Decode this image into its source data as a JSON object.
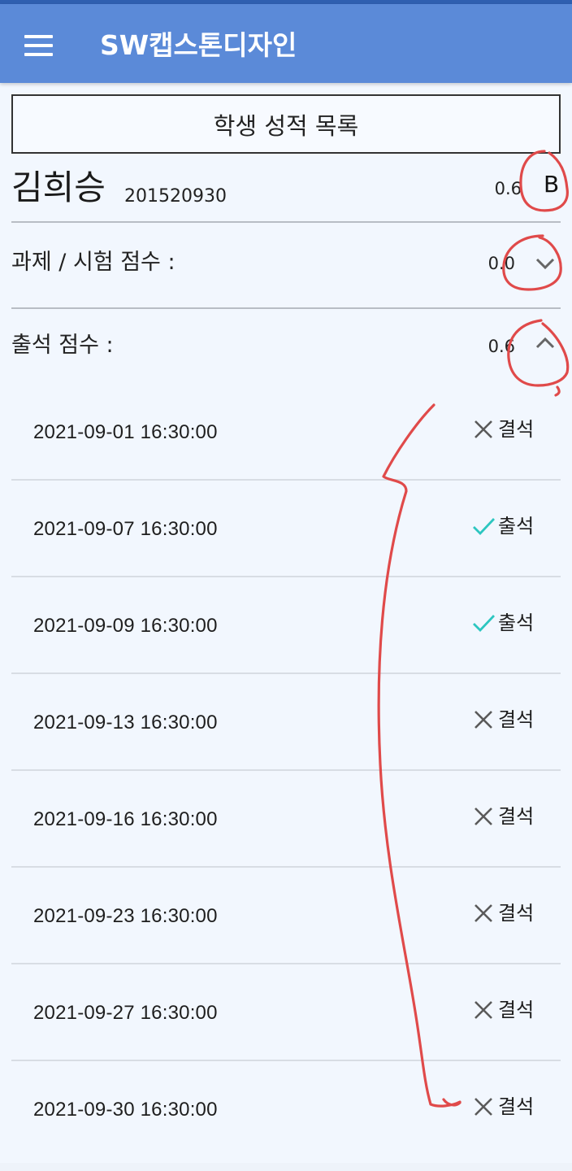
{
  "appbar": {
    "title": "SW캡스톤디자인",
    "menu_icon": "menu-icon"
  },
  "list_button": {
    "label": "학생 성적 목록"
  },
  "student": {
    "name": "김희승",
    "id": "201520930",
    "total_score": "0.6",
    "grade": "B"
  },
  "sections": [
    {
      "label": "과제 / 시험 점수 :",
      "score": "0.0",
      "icon": "chevron-down-icon",
      "expanded": false
    },
    {
      "label": "출석 점수 :",
      "score": "0.6",
      "icon": "chevron-up-icon",
      "expanded": true
    }
  ],
  "attendance": [
    {
      "date": "2021-09-01 16:30:00",
      "status": "결석",
      "icon": "x-icon"
    },
    {
      "date": "2021-09-07 16:30:00",
      "status": "출석",
      "icon": "check-icon"
    },
    {
      "date": "2021-09-09 16:30:00",
      "status": "출석",
      "icon": "check-icon"
    },
    {
      "date": "2021-09-13 16:30:00",
      "status": "결석",
      "icon": "x-icon"
    },
    {
      "date": "2021-09-16 16:30:00",
      "status": "결석",
      "icon": "x-icon"
    },
    {
      "date": "2021-09-23 16:30:00",
      "status": "결석",
      "icon": "x-icon"
    },
    {
      "date": "2021-09-27 16:30:00",
      "status": "결석",
      "icon": "x-icon"
    },
    {
      "date": "2021-09-30 16:30:00",
      "status": "결석",
      "icon": "x-icon"
    }
  ],
  "colors": {
    "appbar": "#5b8ad8",
    "check": "#2cc6c0",
    "x": "#5a5a5a",
    "annotation": "#e04a4a",
    "background": "#f2f7fe"
  }
}
